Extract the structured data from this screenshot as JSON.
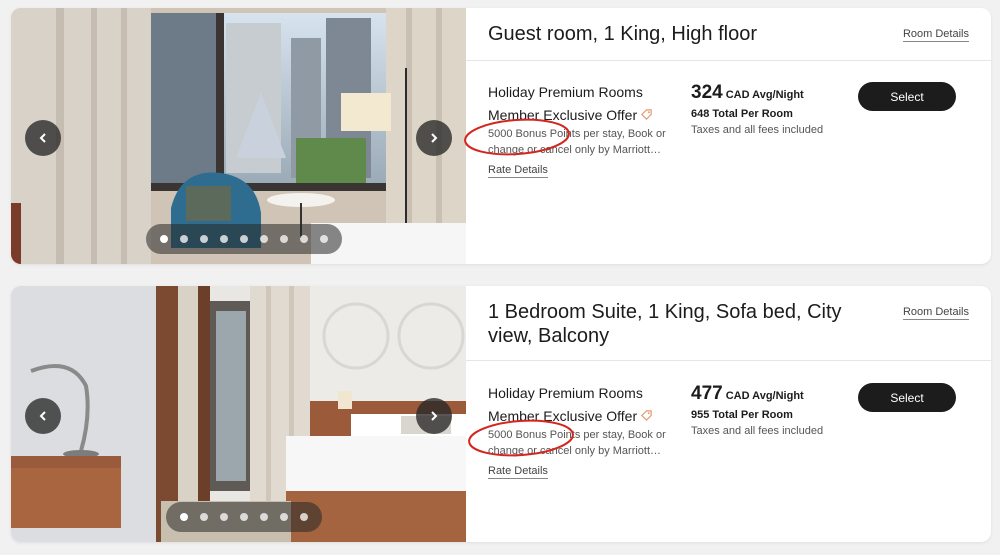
{
  "rooms": [
    {
      "title": "Guest room, 1 King, High floor",
      "room_details_label": "Room Details",
      "rate_name_line1": "Holiday Premium Rooms",
      "rate_name_line2": "Member Exclusive Offer",
      "rate_description": "5000 Bonus Points per stay, Book or change or cancel only by Marriott…",
      "rate_details_label": "Rate Details",
      "price_amount": "324",
      "price_unit": "CAD Avg/Night",
      "price_total": "648 Total Per Room",
      "price_taxes": "Taxes and all fees included",
      "select_label": "Select",
      "carousel": {
        "dot_count": 9,
        "active_dot": 0
      },
      "tag_icon": "tag-icon"
    },
    {
      "title": "1 Bedroom Suite, 1 King, Sofa bed, City view, Balcony",
      "room_details_label": "Room Details",
      "rate_name_line1": "Holiday Premium Rooms",
      "rate_name_line2": "Member Exclusive Offer",
      "rate_description": "5000 Bonus Points per stay, Book or change or cancel only by Marriott…",
      "rate_details_label": "Rate Details",
      "price_amount": "477",
      "price_unit": "CAD Avg/Night",
      "price_total": "955 Total Per Room",
      "price_taxes": "Taxes and all fees included",
      "select_label": "Select",
      "carousel": {
        "dot_count": 7,
        "active_dot": 0
      },
      "tag_icon": "tag-icon"
    }
  ],
  "colors": {
    "button_bg": "#1c1c1c",
    "button_text": "#ffffff",
    "annotation_red": "#d3261f",
    "tag_icon": "#e39a6e"
  }
}
